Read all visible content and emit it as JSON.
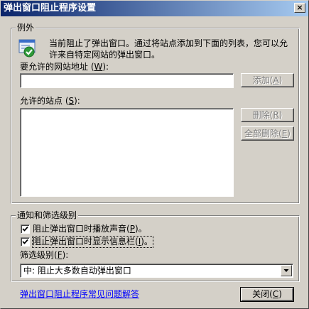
{
  "window": {
    "title": "弹出窗口阻止程序设置",
    "close_glyph": "×"
  },
  "exceptions": {
    "legend": "例外",
    "description_line1": "当前阻止了弹出窗口。通过将站点添加到下面的列表，您可以允",
    "description_line2": "许来自特定网站的弹出窗口。",
    "address_label": "要允许的网站地址 (",
    "address_key": "W",
    "address_label_end": "):",
    "address_value": "",
    "add_button": "添加(",
    "add_key": "A",
    "add_button_end": ")",
    "allowed_label": "允许的站点 (",
    "allowed_key": "S",
    "allowed_label_end": "):",
    "allowed_sites": [],
    "remove_button": "删除(",
    "remove_key": "R",
    "remove_button_end": ")",
    "remove_all_button": "全部删除(",
    "remove_all_key": "E",
    "remove_all_button_end": ")"
  },
  "notification": {
    "legend": "通知和筛选级别",
    "play_sound_label": "阻止弹出窗口时播放声音(",
    "play_sound_key": "P",
    "play_sound_end": ")。",
    "play_sound_checked": true,
    "info_bar_label": "阻止弹出窗口时显示信息栏(",
    "info_bar_key": "I",
    "info_bar_end": ")。",
    "info_bar_checked": true,
    "filter_label": "筛选级别(",
    "filter_key": "F",
    "filter_label_end": "):",
    "filter_selected": "中: 阻止大多数自动弹出窗口"
  },
  "footer": {
    "faq_link": "弹出窗口阻止程序常见问题解答",
    "close_button": "关闭(",
    "close_key": "C",
    "close_button_end": ")"
  },
  "icons": {
    "exceptions_icon": "popup-blocker-shield-icon",
    "check": "checkmark-icon",
    "dropdown": "chevron-down-icon",
    "title_close": "close-icon"
  },
  "colors": {
    "face": "#d4d0c8",
    "title_start": "#0a246a",
    "title_end": "#a6caf0",
    "link": "#0000ff",
    "disabled_text": "#808080"
  }
}
